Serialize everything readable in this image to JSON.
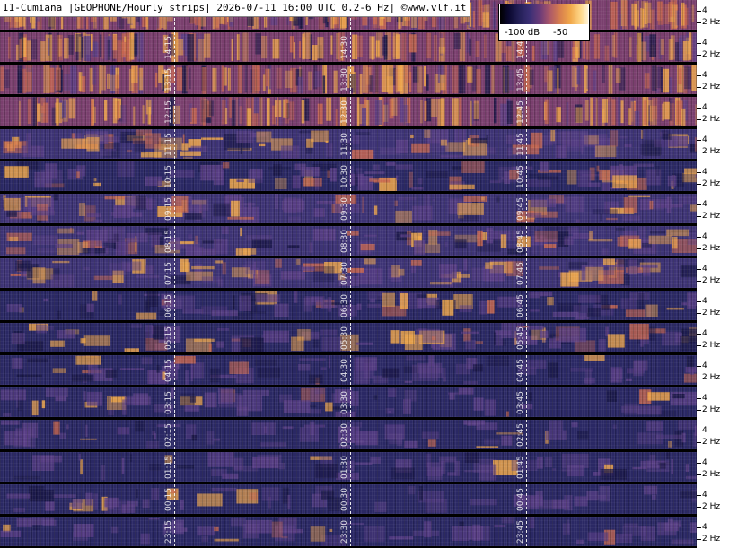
{
  "header": {
    "title": "I1-Cumiana |GEOPHONE/Hourly strips| 2026-07-11 16:00 UTC 0.2-6 Hz| ©www.vlf.it"
  },
  "colorbar": {
    "min_label": "-100 dB",
    "max_label": "-50",
    "colors": [
      "#000000",
      "#242058",
      "#6e3c78",
      "#d77e4e",
      "#f1a84a",
      "#fff3d6"
    ]
  },
  "axis": {
    "tick_high": "4",
    "tick_low": "2 Hz"
  },
  "strips": [
    {
      "hour": "15",
      "labels": [
        "",
        "",
        ""
      ],
      "intensity": 0.92,
      "partial": true
    },
    {
      "hour": "14",
      "labels": [
        "14:15",
        "14:30",
        "14:45"
      ],
      "intensity": 0.85
    },
    {
      "hour": "13",
      "labels": [
        "13:15",
        "13:30",
        "13:45"
      ],
      "intensity": 0.8
    },
    {
      "hour": "12",
      "labels": [
        "12:15",
        "12:30",
        "12:45"
      ],
      "intensity": 0.78
    },
    {
      "hour": "11",
      "labels": [
        "11:15",
        "11:30",
        "11:45"
      ],
      "intensity": 0.5
    },
    {
      "hour": "10",
      "labels": [
        "10:15",
        "10:30",
        "10:45"
      ],
      "intensity": 0.4
    },
    {
      "hour": "09",
      "labels": [
        "09:15",
        "09:30",
        "09:45"
      ],
      "intensity": 0.48
    },
    {
      "hour": "08",
      "labels": [
        "08:15",
        "08:30",
        "08:45"
      ],
      "intensity": 0.46
    },
    {
      "hour": "07",
      "labels": [
        "07:15",
        "07:30",
        "07:45"
      ],
      "intensity": 0.44
    },
    {
      "hour": "06",
      "labels": [
        "06:15",
        "06:30",
        "06:45"
      ],
      "intensity": 0.38
    },
    {
      "hour": "05",
      "labels": [
        "05:15",
        "05:30",
        "05:45"
      ],
      "intensity": 0.36
    },
    {
      "hour": "04",
      "labels": [
        "04:15",
        "04:30",
        "04:45"
      ],
      "intensity": 0.26
    },
    {
      "hour": "03",
      "labels": [
        "03:15",
        "03:30",
        "03:45"
      ],
      "intensity": 0.2
    },
    {
      "hour": "02",
      "labels": [
        "02:15",
        "02:30",
        "02:45"
      ],
      "intensity": 0.16
    },
    {
      "hour": "01",
      "labels": [
        "01:15",
        "01:30",
        "01:45"
      ],
      "intensity": 0.15
    },
    {
      "hour": "00",
      "labels": [
        "00:15",
        "00:30",
        "00:45"
      ],
      "intensity": 0.14
    },
    {
      "hour": "23",
      "labels": [
        "23:15",
        "23:30",
        "23:45"
      ],
      "intensity": 0.14
    }
  ]
}
